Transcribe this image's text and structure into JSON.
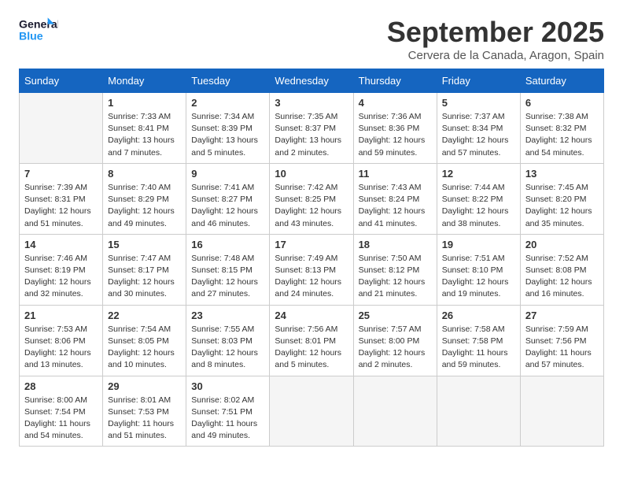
{
  "logo": {
    "line1": "General",
    "line2": "Blue"
  },
  "title": "September 2025",
  "subtitle": "Cervera de la Canada, Aragon, Spain",
  "days_of_week": [
    "Sunday",
    "Monday",
    "Tuesday",
    "Wednesday",
    "Thursday",
    "Friday",
    "Saturday"
  ],
  "weeks": [
    [
      {
        "day": "",
        "sunrise": "",
        "sunset": "",
        "daylight": ""
      },
      {
        "day": "1",
        "sunrise": "Sunrise: 7:33 AM",
        "sunset": "Sunset: 8:41 PM",
        "daylight": "Daylight: 13 hours and 7 minutes."
      },
      {
        "day": "2",
        "sunrise": "Sunrise: 7:34 AM",
        "sunset": "Sunset: 8:39 PM",
        "daylight": "Daylight: 13 hours and 5 minutes."
      },
      {
        "day": "3",
        "sunrise": "Sunrise: 7:35 AM",
        "sunset": "Sunset: 8:37 PM",
        "daylight": "Daylight: 13 hours and 2 minutes."
      },
      {
        "day": "4",
        "sunrise": "Sunrise: 7:36 AM",
        "sunset": "Sunset: 8:36 PM",
        "daylight": "Daylight: 12 hours and 59 minutes."
      },
      {
        "day": "5",
        "sunrise": "Sunrise: 7:37 AM",
        "sunset": "Sunset: 8:34 PM",
        "daylight": "Daylight: 12 hours and 57 minutes."
      },
      {
        "day": "6",
        "sunrise": "Sunrise: 7:38 AM",
        "sunset": "Sunset: 8:32 PM",
        "daylight": "Daylight: 12 hours and 54 minutes."
      }
    ],
    [
      {
        "day": "7",
        "sunrise": "Sunrise: 7:39 AM",
        "sunset": "Sunset: 8:31 PM",
        "daylight": "Daylight: 12 hours and 51 minutes."
      },
      {
        "day": "8",
        "sunrise": "Sunrise: 7:40 AM",
        "sunset": "Sunset: 8:29 PM",
        "daylight": "Daylight: 12 hours and 49 minutes."
      },
      {
        "day": "9",
        "sunrise": "Sunrise: 7:41 AM",
        "sunset": "Sunset: 8:27 PM",
        "daylight": "Daylight: 12 hours and 46 minutes."
      },
      {
        "day": "10",
        "sunrise": "Sunrise: 7:42 AM",
        "sunset": "Sunset: 8:25 PM",
        "daylight": "Daylight: 12 hours and 43 minutes."
      },
      {
        "day": "11",
        "sunrise": "Sunrise: 7:43 AM",
        "sunset": "Sunset: 8:24 PM",
        "daylight": "Daylight: 12 hours and 41 minutes."
      },
      {
        "day": "12",
        "sunrise": "Sunrise: 7:44 AM",
        "sunset": "Sunset: 8:22 PM",
        "daylight": "Daylight: 12 hours and 38 minutes."
      },
      {
        "day": "13",
        "sunrise": "Sunrise: 7:45 AM",
        "sunset": "Sunset: 8:20 PM",
        "daylight": "Daylight: 12 hours and 35 minutes."
      }
    ],
    [
      {
        "day": "14",
        "sunrise": "Sunrise: 7:46 AM",
        "sunset": "Sunset: 8:19 PM",
        "daylight": "Daylight: 12 hours and 32 minutes."
      },
      {
        "day": "15",
        "sunrise": "Sunrise: 7:47 AM",
        "sunset": "Sunset: 8:17 PM",
        "daylight": "Daylight: 12 hours and 30 minutes."
      },
      {
        "day": "16",
        "sunrise": "Sunrise: 7:48 AM",
        "sunset": "Sunset: 8:15 PM",
        "daylight": "Daylight: 12 hours and 27 minutes."
      },
      {
        "day": "17",
        "sunrise": "Sunrise: 7:49 AM",
        "sunset": "Sunset: 8:13 PM",
        "daylight": "Daylight: 12 hours and 24 minutes."
      },
      {
        "day": "18",
        "sunrise": "Sunrise: 7:50 AM",
        "sunset": "Sunset: 8:12 PM",
        "daylight": "Daylight: 12 hours and 21 minutes."
      },
      {
        "day": "19",
        "sunrise": "Sunrise: 7:51 AM",
        "sunset": "Sunset: 8:10 PM",
        "daylight": "Daylight: 12 hours and 19 minutes."
      },
      {
        "day": "20",
        "sunrise": "Sunrise: 7:52 AM",
        "sunset": "Sunset: 8:08 PM",
        "daylight": "Daylight: 12 hours and 16 minutes."
      }
    ],
    [
      {
        "day": "21",
        "sunrise": "Sunrise: 7:53 AM",
        "sunset": "Sunset: 8:06 PM",
        "daylight": "Daylight: 12 hours and 13 minutes."
      },
      {
        "day": "22",
        "sunrise": "Sunrise: 7:54 AM",
        "sunset": "Sunset: 8:05 PM",
        "daylight": "Daylight: 12 hours and 10 minutes."
      },
      {
        "day": "23",
        "sunrise": "Sunrise: 7:55 AM",
        "sunset": "Sunset: 8:03 PM",
        "daylight": "Daylight: 12 hours and 8 minutes."
      },
      {
        "day": "24",
        "sunrise": "Sunrise: 7:56 AM",
        "sunset": "Sunset: 8:01 PM",
        "daylight": "Daylight: 12 hours and 5 minutes."
      },
      {
        "day": "25",
        "sunrise": "Sunrise: 7:57 AM",
        "sunset": "Sunset: 8:00 PM",
        "daylight": "Daylight: 12 hours and 2 minutes."
      },
      {
        "day": "26",
        "sunrise": "Sunrise: 7:58 AM",
        "sunset": "Sunset: 7:58 PM",
        "daylight": "Daylight: 11 hours and 59 minutes."
      },
      {
        "day": "27",
        "sunrise": "Sunrise: 7:59 AM",
        "sunset": "Sunset: 7:56 PM",
        "daylight": "Daylight: 11 hours and 57 minutes."
      }
    ],
    [
      {
        "day": "28",
        "sunrise": "Sunrise: 8:00 AM",
        "sunset": "Sunset: 7:54 PM",
        "daylight": "Daylight: 11 hours and 54 minutes."
      },
      {
        "day": "29",
        "sunrise": "Sunrise: 8:01 AM",
        "sunset": "Sunset: 7:53 PM",
        "daylight": "Daylight: 11 hours and 51 minutes."
      },
      {
        "day": "30",
        "sunrise": "Sunrise: 8:02 AM",
        "sunset": "Sunset: 7:51 PM",
        "daylight": "Daylight: 11 hours and 49 minutes."
      },
      {
        "day": "",
        "sunrise": "",
        "sunset": "",
        "daylight": ""
      },
      {
        "day": "",
        "sunrise": "",
        "sunset": "",
        "daylight": ""
      },
      {
        "day": "",
        "sunrise": "",
        "sunset": "",
        "daylight": ""
      },
      {
        "day": "",
        "sunrise": "",
        "sunset": "",
        "daylight": ""
      }
    ]
  ]
}
